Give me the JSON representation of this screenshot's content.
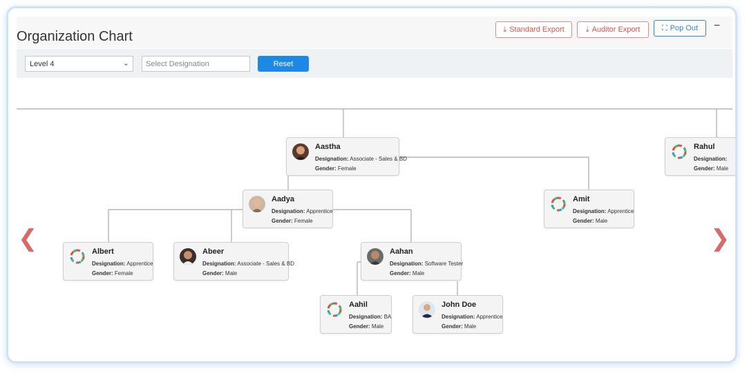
{
  "title": "Organization Chart",
  "buttons": {
    "standard_export": "Standard Export",
    "auditor_export": "Auditor Export",
    "pop_out": "Pop Out",
    "minimize": "−"
  },
  "filters": {
    "level": "Level 4",
    "designation_placeholder": "Select Designation",
    "reset": "Reset"
  },
  "labels": {
    "designation": "Designation:",
    "gender": "Gender:"
  },
  "nav": {
    "prev": "❮",
    "next": "❯"
  },
  "people": [
    {
      "name": "Aastha",
      "designation": "Associate - Sales & BD",
      "gender": "Female",
      "avatar": "photo-female-dark"
    },
    {
      "name": "Rahul",
      "designation": "",
      "gender": "Male",
      "avatar": "default-rainbow-avatar"
    },
    {
      "name": "Aadya",
      "designation": "Apprentice",
      "gender": "Female",
      "avatar": "photo-female"
    },
    {
      "name": "Amit",
      "designation": "Apprentice",
      "gender": "Male",
      "avatar": "default-rainbow-avatar"
    },
    {
      "name": "Albert",
      "designation": "Apprentice",
      "gender": "Female",
      "avatar": "default-rainbow-avatar"
    },
    {
      "name": "Abeer",
      "designation": "Associate - Sales & BD",
      "gender": "Male",
      "avatar": "photo-male"
    },
    {
      "name": "Aahan",
      "designation": "Software Tester",
      "gender": "Male",
      "avatar": "photo-male-beard"
    },
    {
      "name": "Aahil",
      "designation": "BA",
      "gender": "Male",
      "avatar": "default-rainbow-avatar"
    },
    {
      "name": "John Doe",
      "designation": "Apprentice",
      "gender": "Male",
      "avatar": "photo-male-suit"
    }
  ]
}
